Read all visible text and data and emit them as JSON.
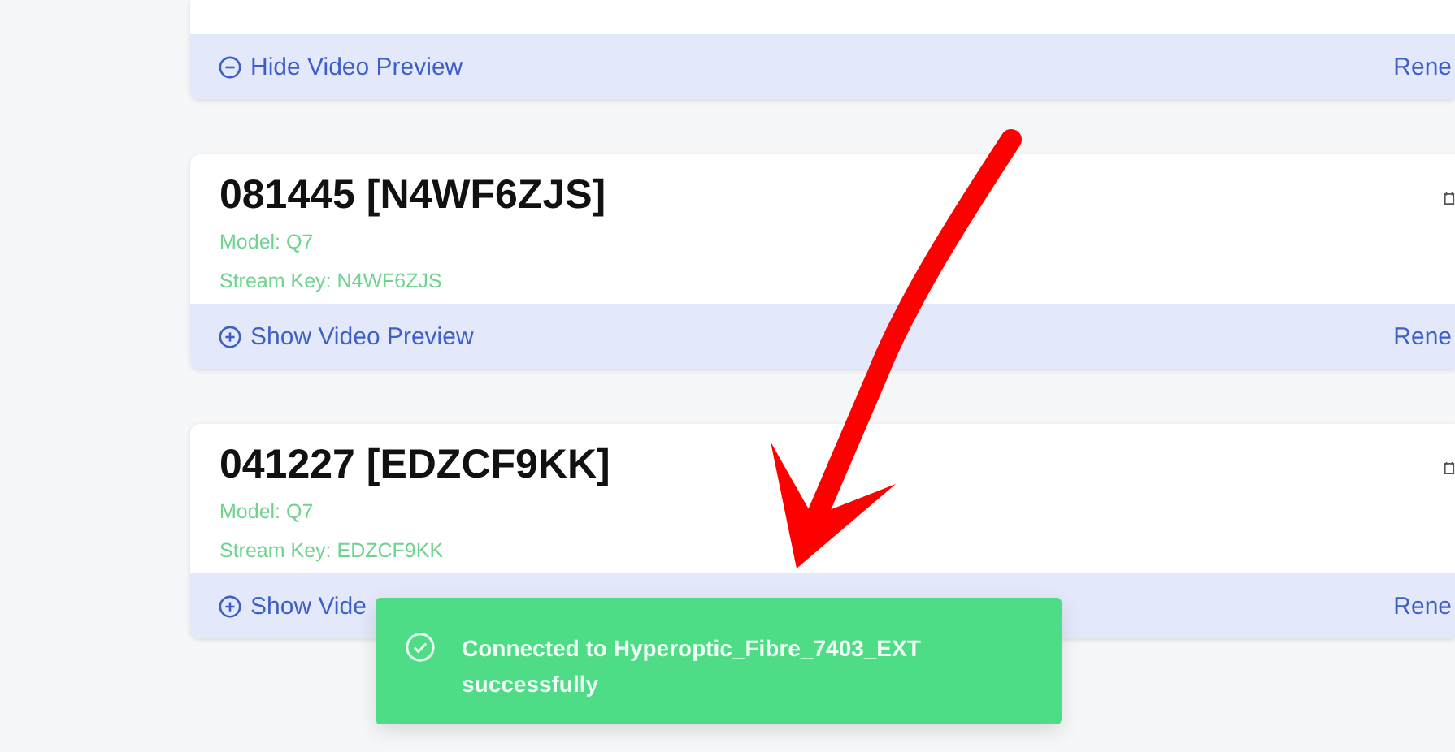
{
  "cards": [
    {
      "preview_toggle": {
        "label": "Hide Video Preview",
        "expanded": true
      },
      "renew": "Rene"
    },
    {
      "title": "081445 [N4WF6ZJS]",
      "model": "Model: Q7",
      "stream_key": "Stream Key: N4WF6ZJS",
      "preview_toggle": {
        "label": "Show Video Preview",
        "expanded": false
      },
      "renew": "Rene"
    },
    {
      "title": "041227 [EDZCF9KK]",
      "model": "Model: Q7",
      "stream_key": "Stream Key: EDZCF9KK",
      "preview_toggle": {
        "label": "Show Vide",
        "expanded": false
      },
      "renew": "Rene"
    }
  ],
  "toast": {
    "message": "Connected to Hyperoptic_Fibre_7403_EXT successfully"
  }
}
